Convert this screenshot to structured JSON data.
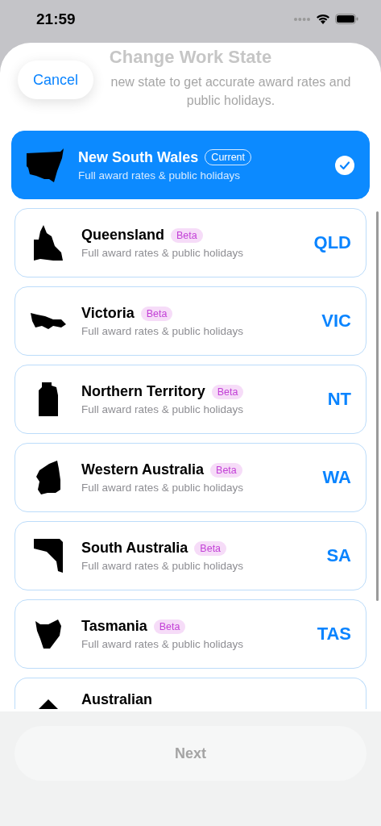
{
  "status_bar": {
    "time": "21:59"
  },
  "sheet": {
    "title": "Change Work State",
    "subtitle": "new state to get accurate award rates and public holidays.",
    "cancel": "Cancel"
  },
  "states": [
    {
      "name": "New South Wales",
      "badge": {
        "text": "Current",
        "kind": "current"
      },
      "description": "Full award rates & public holidays",
      "selected": true
    },
    {
      "name": "Queensland",
      "badge": {
        "text": "Beta",
        "kind": "beta"
      },
      "description": "Full award rates & public holidays",
      "code": "QLD",
      "selected": false
    },
    {
      "name": "Victoria",
      "badge": {
        "text": "Beta",
        "kind": "beta"
      },
      "description": "Full award rates & public holidays",
      "code": "VIC",
      "selected": false
    },
    {
      "name": "Northern Territory",
      "badge": {
        "text": "Beta",
        "kind": "beta"
      },
      "description": "Full award rates & public holidays",
      "code": "NT",
      "selected": false
    },
    {
      "name": "Western Australia",
      "badge": {
        "text": "Beta",
        "kind": "beta"
      },
      "description": "Full award rates & public holidays",
      "code": "WA",
      "selected": false
    },
    {
      "name": "South Australia",
      "badge": {
        "text": "Beta",
        "kind": "beta"
      },
      "description": "Full award rates & public holidays",
      "code": "SA",
      "selected": false
    },
    {
      "name": "Tasmania",
      "badge": {
        "text": "Beta",
        "kind": "beta"
      },
      "description": "Full award rates & public holidays",
      "code": "TAS",
      "selected": false
    },
    {
      "name": "Australian",
      "selected": false,
      "clipped": true
    }
  ],
  "next_button": {
    "label": "Next",
    "disabled": true
  }
}
